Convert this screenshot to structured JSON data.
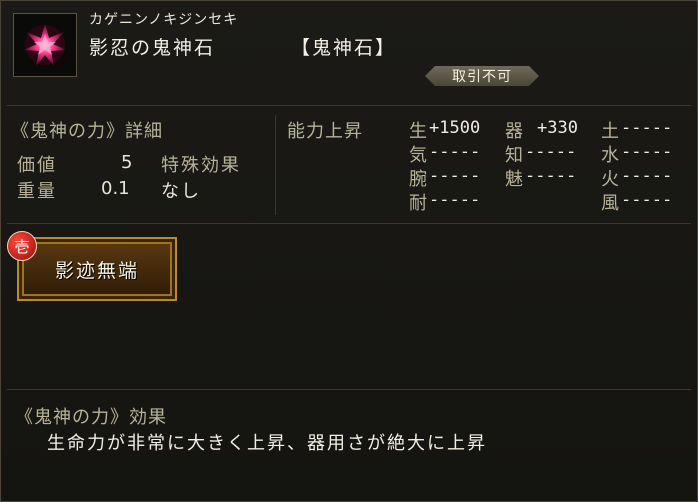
{
  "item": {
    "icon": "crystal-gem-icon",
    "kana": "カゲニンノキジンセキ",
    "name": "影忍の鬼神石",
    "category": "【鬼神石】",
    "untradable": "取引不可"
  },
  "details": {
    "title": "《鬼神の力》詳細",
    "price_label": "価値",
    "price_value": "5",
    "weight_label": "重量",
    "weight_value": "0.1",
    "special_label": "特殊効果",
    "special_value": "なし"
  },
  "stats": {
    "title": "能力上昇",
    "col1": [
      {
        "label": "生",
        "value": "+1500"
      },
      {
        "label": "気",
        "value": "-----"
      },
      {
        "label": "腕",
        "value": "-----"
      },
      {
        "label": "耐",
        "value": "-----"
      }
    ],
    "col2": [
      {
        "label": "器",
        "value": "+330"
      },
      {
        "label": "知",
        "value": "-----"
      },
      {
        "label": "魅",
        "value": "-----"
      }
    ],
    "col3": [
      {
        "label": "土",
        "value": "-----"
      },
      {
        "label": "水",
        "value": "-----"
      },
      {
        "label": "火",
        "value": "-----"
      },
      {
        "label": "風",
        "value": "-----"
      }
    ]
  },
  "skill": {
    "rank": "壱",
    "label": "影迹無端"
  },
  "effect": {
    "title": "《鬼神の力》効果",
    "text": "生命力が非常に大きく上昇、器用さが絶大に上昇"
  },
  "colors": {
    "accent_gold": "#b98a2b",
    "badge_red": "#c81a10",
    "label_tan": "#b9b29a"
  }
}
